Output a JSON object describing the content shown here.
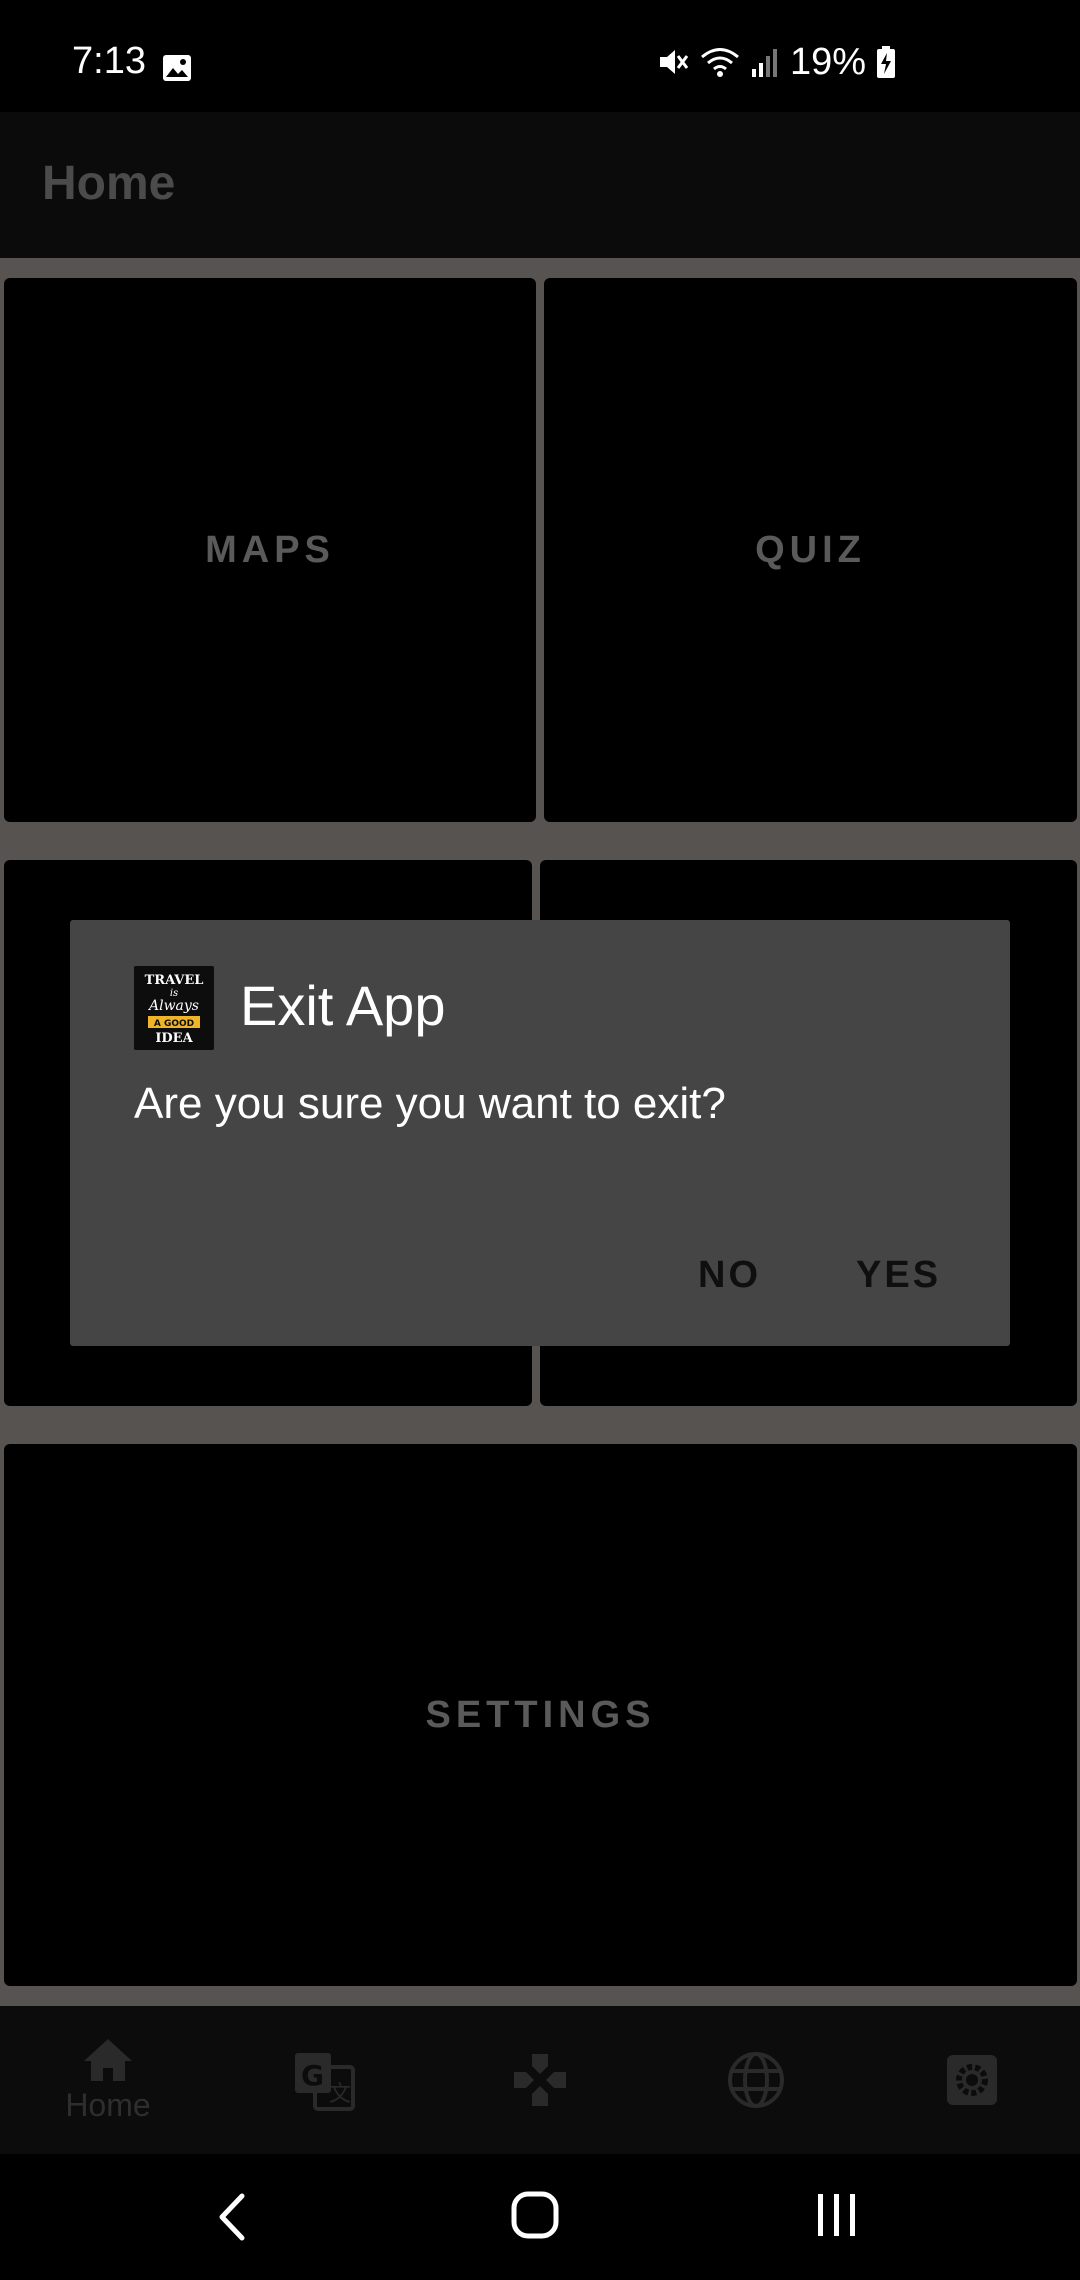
{
  "status_bar": {
    "time": "7:13",
    "battery": "19%",
    "icons": [
      "image-icon",
      "mute-icon",
      "wifi-icon",
      "signal-icon",
      "battery-charging-icon"
    ]
  },
  "app_bar": {
    "title": "Home"
  },
  "tiles": {
    "maps": "MAPS",
    "quiz": "QUIZ",
    "settings": "SETTINGS"
  },
  "bottom_nav": {
    "items": [
      {
        "label": "Home",
        "icon": "home-icon",
        "active": true
      },
      {
        "label": "",
        "icon": "translate-icon"
      },
      {
        "label": "",
        "icon": "gamepad-icon"
      },
      {
        "label": "",
        "icon": "globe-icon"
      },
      {
        "label": "",
        "icon": "settings-icon"
      }
    ]
  },
  "dialog": {
    "title": "Exit App",
    "message": "Are you sure you want to exit?",
    "logo_text": [
      "TRAVEL",
      "is",
      "Always",
      "A GOOD",
      "IDEA"
    ],
    "no_label": "NO",
    "yes_label": "YES"
  },
  "colors": {
    "dialog_bg": "#454545",
    "scrim_bg": "#565350",
    "tile_bg": "#000000",
    "accent_logo": "#f0b429"
  }
}
